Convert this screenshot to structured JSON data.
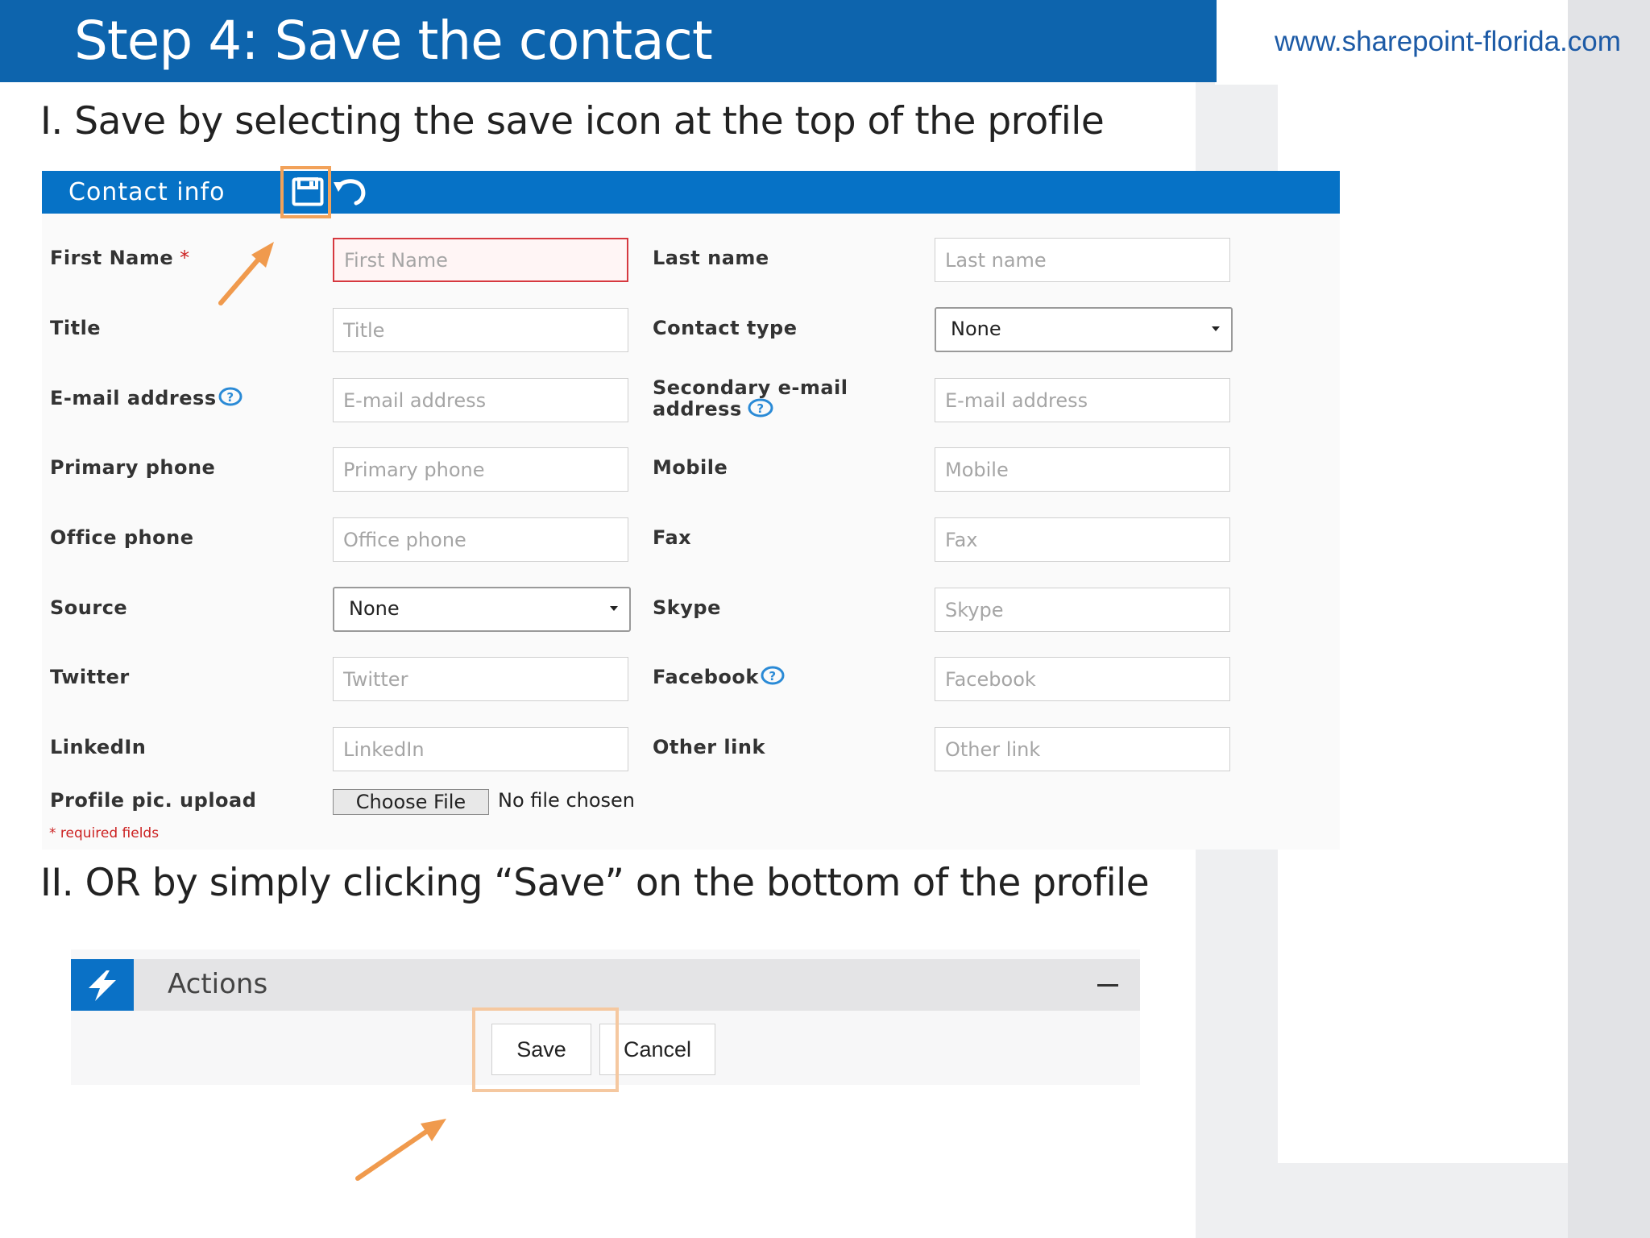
{
  "colors": {
    "title_bar": "#0d64ad",
    "form_header": "#0672c6",
    "highlight": "#f2a25a",
    "arrow": "#f09a4d",
    "required": "#cc2222"
  },
  "slide": {
    "title": "Step 4: Save the contact",
    "url": "www.sharepoint-florida.com",
    "step_one": "I. Save by selecting the save icon at the top of the profile",
    "step_two": "II. OR by simply clicking “Save” on the bottom of the profile"
  },
  "form": {
    "header_title": "Contact info",
    "header_icons": [
      "save-icon",
      "undo-icon"
    ],
    "first_name": {
      "label": "First Name",
      "required_mark": "*",
      "placeholder": "First Name"
    },
    "last_name": {
      "label": "Last name",
      "placeholder": "Last name"
    },
    "title": {
      "label": "Title",
      "placeholder": "Title"
    },
    "contact_type": {
      "label": "Contact type",
      "value": "None"
    },
    "email": {
      "label": "E-mail address",
      "placeholder": "E-mail address"
    },
    "secondary_email": {
      "label_line1": "Secondary e-mail",
      "label_line2": "address",
      "placeholder": "E-mail address"
    },
    "primary_phone": {
      "label": "Primary phone",
      "placeholder": "Primary phone"
    },
    "mobile": {
      "label": "Mobile",
      "placeholder": "Mobile"
    },
    "office_phone": {
      "label": "Office phone",
      "placeholder": "Office phone"
    },
    "fax": {
      "label": "Fax",
      "placeholder": "Fax"
    },
    "source": {
      "label": "Source",
      "value": "None"
    },
    "skype": {
      "label": "Skype",
      "placeholder": "Skype"
    },
    "twitter": {
      "label": "Twitter",
      "placeholder": "Twitter"
    },
    "facebook": {
      "label": "Facebook",
      "placeholder": "Facebook"
    },
    "linkedin": {
      "label": "LinkedIn",
      "placeholder": "LinkedIn"
    },
    "other_link": {
      "label": "Other link",
      "placeholder": "Other link"
    },
    "profile_pic": {
      "label": "Profile pic. upload",
      "button": "Choose File",
      "status": "No file chosen"
    },
    "required_note": "* required fields"
  },
  "actions": {
    "title": "Actions",
    "save_label": "Save",
    "cancel_label": "Cancel"
  }
}
